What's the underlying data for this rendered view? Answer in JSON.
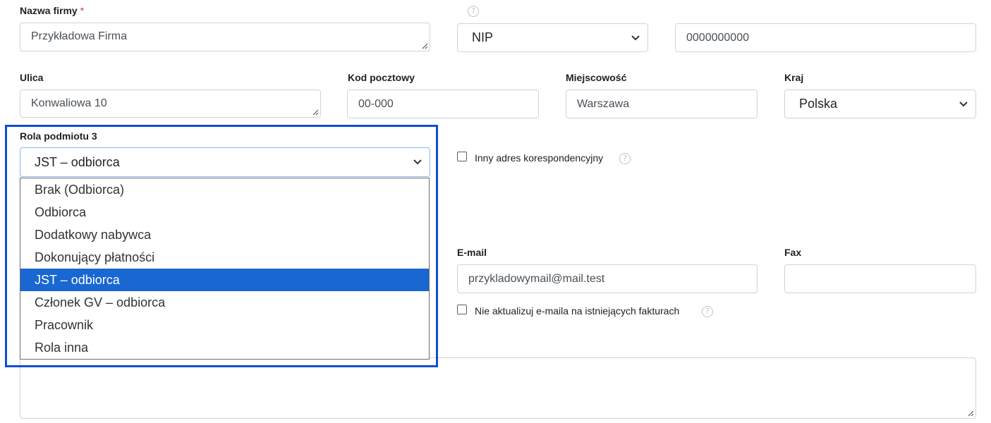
{
  "company": {
    "label": "Nazwa firmy",
    "required_mark": "*",
    "value": "Przykładowa Firma",
    "help_glyph": "?",
    "id_type_selected": "NIP",
    "id_value": "0000000000"
  },
  "address": {
    "street_label": "Ulica",
    "street_value": "Konwaliowa 10",
    "postal_label": "Kod pocztowy",
    "postal_value": "00-000",
    "city_label": "Miejscowość",
    "city_value": "Warszawa",
    "country_label": "Kraj",
    "country_selected": "Polska"
  },
  "role": {
    "label": "Rola podmiotu 3",
    "selected": "JST – odbiorca",
    "options": [
      "Brak (Odbiorca)",
      "Odbiorca",
      "Dodatkowy nabywca",
      "Dokonujący płatności",
      "JST – odbiorca",
      "Członek GV – odbiorca",
      "Pracownik",
      "Rola inna"
    ],
    "selected_index": 4
  },
  "correspondence": {
    "checkbox_label": "Inny adres korespondencyjny",
    "checked": false
  },
  "contact": {
    "email_label": "E-mail",
    "email_value": "przykladowymail@mail.test",
    "fax_label": "Fax",
    "fax_value": "",
    "no_update_label": "Nie aktualizuj e-maila na istniejących fakturach",
    "no_update_checked": false
  },
  "colors": {
    "highlight": "#0b4fd6",
    "selected_option": "#1967d2",
    "required": "#dc3545"
  },
  "icons": {
    "select_arrow": "chevron-down-icon",
    "textarea_grip": "resize-grip-icon",
    "help": "help-icon"
  }
}
